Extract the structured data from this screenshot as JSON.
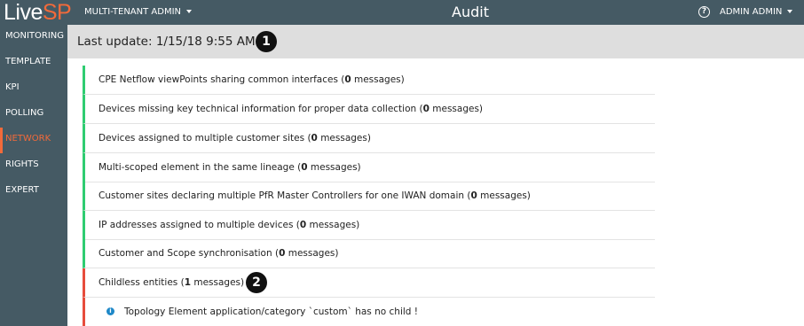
{
  "app": {
    "logo_live": "Live",
    "logo_sp": "SP",
    "tenant": "MULTI-TENANT ADMIN",
    "title": "Audit",
    "help_icon": "help-circle-icon",
    "help_glyph": "?",
    "user": "ADMIN ADMIN",
    "accent_color": "#f26a3a",
    "header_color": "#455a64"
  },
  "sidebar": {
    "items": [
      {
        "label": "MONITORING",
        "active": false
      },
      {
        "label": "TEMPLATE",
        "active": false
      },
      {
        "label": "KPI",
        "active": false
      },
      {
        "label": "POLLING",
        "active": false
      },
      {
        "label": "NETWORK",
        "active": true
      },
      {
        "label": "RIGHTS",
        "active": false
      },
      {
        "label": "EXPERT",
        "active": false
      }
    ]
  },
  "update": {
    "text": "Last update: 1/15/18 9:55 AM",
    "refresh_icon": "refresh-icon",
    "badge": "1"
  },
  "audits": [
    {
      "text": "CPE Netflow viewPoints sharing common interfaces (",
      "count": "0",
      "suffix": " messages)",
      "status": "ok"
    },
    {
      "text": "Devices missing key technical information for proper data collection (",
      "count": "0",
      "suffix": " messages)",
      "status": "ok"
    },
    {
      "text": "Devices assigned to multiple customer sites (",
      "count": "0",
      "suffix": " messages)",
      "status": "ok"
    },
    {
      "text": "Multi-scoped element in the same lineage (",
      "count": "0",
      "suffix": " messages)",
      "status": "ok"
    },
    {
      "text": "Customer sites declaring multiple PfR Master Controllers for one IWAN domain (",
      "count": "0",
      "suffix": " messages)",
      "status": "ok"
    },
    {
      "text": "IP addresses assigned to multiple devices (",
      "count": "0",
      "suffix": " messages)",
      "status": "ok"
    },
    {
      "text": "Customer and Scope synchronisation (",
      "count": "0",
      "suffix": " messages)",
      "status": "ok"
    },
    {
      "text": "Childless entities (",
      "count": "1",
      "suffix": " messages)",
      "status": "error"
    }
  ],
  "expanded": {
    "badge": "2",
    "chevron_icon": "chevron-down-icon",
    "info_icon": "info-icon",
    "info_glyph": "i",
    "message": "Topology Element application/category `custom` has no child !"
  },
  "status_colors": {
    "ok": "#2ecc71",
    "error": "#e74c3c"
  }
}
